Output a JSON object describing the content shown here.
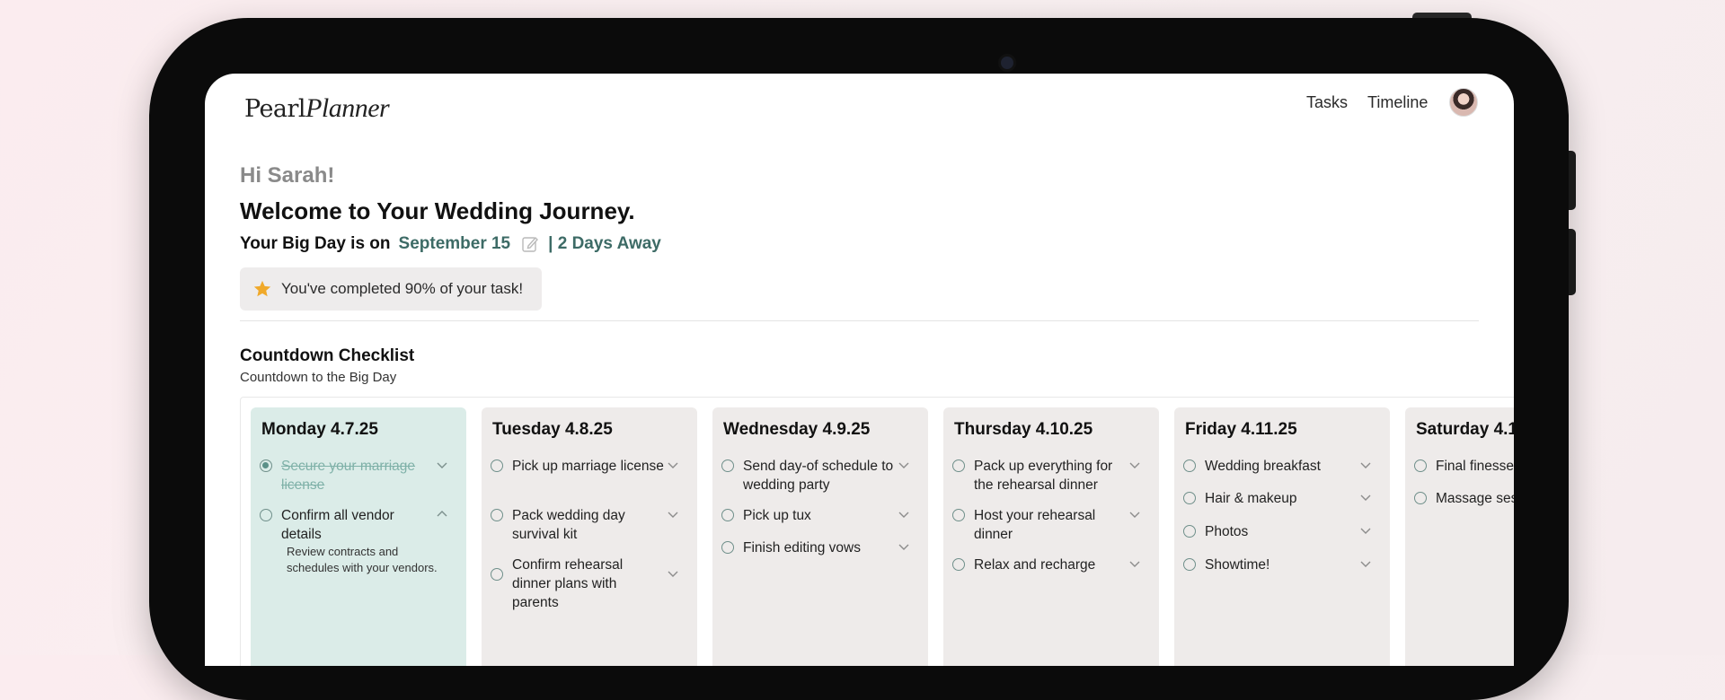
{
  "app": {
    "logo_main": "Pearl",
    "logo_script": "Planner"
  },
  "nav": {
    "tasks": "Tasks",
    "timeline": "Timeline"
  },
  "hero": {
    "greeting": "Hi Sarah!",
    "welcome": "Welcome to Your Wedding Journey.",
    "bigday_prefix": "Your Big Day is on",
    "date": "September 15",
    "days_away": "| 2 Days Away",
    "progress_text": "You've completed 90% of your task!",
    "progress_percent": 90
  },
  "checklist": {
    "title": "Countdown Checklist",
    "subtitle": "Countdown to the Big Day",
    "days": [
      {
        "title": "Monday 4.7.25",
        "active": true,
        "tasks": [
          {
            "label": "Secure your marriage license",
            "done": true,
            "expanded": false
          },
          {
            "label": "Confirm all vendor details",
            "done": false,
            "expanded": true,
            "detail": "Review contracts and schedules with your vendors."
          }
        ]
      },
      {
        "title": "Tuesday 4.8.25",
        "tasks": [
          {
            "label": "Pick up marriage license"
          },
          {
            "label": "Pack wedding day survival kit"
          },
          {
            "label": "Confirm rehearsal dinner plans with parents"
          }
        ]
      },
      {
        "title": "Wednesday 4.9.25",
        "tasks": [
          {
            "label": "Send day-of schedule to wedding party"
          },
          {
            "label": "Pick up tux"
          },
          {
            "label": "Finish editing vows"
          }
        ]
      },
      {
        "title": "Thursday 4.10.25",
        "tasks": [
          {
            "label": "Pack up everything for the rehearsal dinner"
          },
          {
            "label": "Host your rehearsal dinner"
          },
          {
            "label": "Relax and recharge"
          }
        ]
      },
      {
        "title": "Friday 4.11.25",
        "tasks": [
          {
            "label": "Wedding breakfast"
          },
          {
            "label": "Hair & makeup"
          },
          {
            "label": "Photos"
          },
          {
            "label": "Showtime!"
          }
        ]
      },
      {
        "title": "Saturday 4.1",
        "tasks": [
          {
            "label": "Final finesse"
          },
          {
            "label": "Massage ses"
          }
        ]
      }
    ]
  },
  "colors": {
    "accent": "#3d6b66",
    "active_column": "#dbece8",
    "column": "#eeebea",
    "star": "#f0a92a"
  },
  "icons": {
    "edit": "pencil-icon",
    "star": "star-icon",
    "chevron": "chevron-icon"
  }
}
